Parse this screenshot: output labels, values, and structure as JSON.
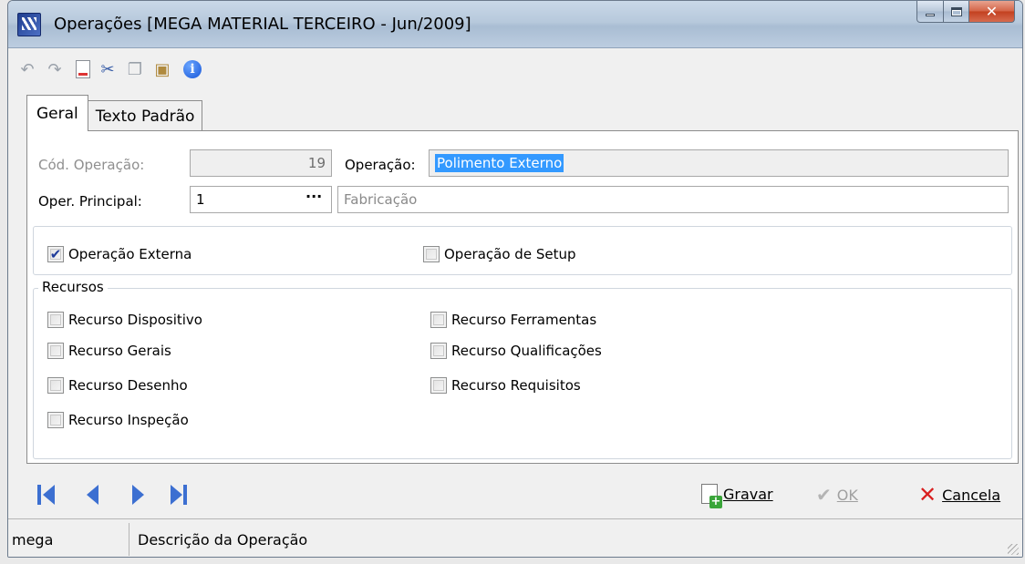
{
  "window": {
    "title": "Operações [MEGA MATERIAL TERCEIRO - Jun/2009]"
  },
  "toolbar": {
    "icons": [
      "undo-icon",
      "redo-icon",
      "new-document-icon",
      "cut-icon",
      "copy-icon",
      "paste-icon",
      "info-icon"
    ]
  },
  "tabs": [
    {
      "label": "Geral",
      "active": true
    },
    {
      "label": "Texto Padrão",
      "active": false
    }
  ],
  "form": {
    "cod_operacao_label": "Cód. Operação:",
    "cod_operacao_value": "19",
    "operacao_label": "Operação:",
    "operacao_value": "Polimento Externo",
    "oper_principal_label": "Oper. Principal:",
    "oper_principal_value": "1",
    "oper_principal_ellipsis": "···",
    "oper_principal_desc": "Fabricação"
  },
  "options": {
    "operacao_externa": {
      "label": "Operação Externa",
      "checked": true
    },
    "operacao_setup": {
      "label": "Operação de Setup",
      "checked": false
    }
  },
  "recursos": {
    "caption": "Recursos",
    "dispositivo": "Recurso Dispositivo",
    "gerais": "Recurso Gerais",
    "desenho": "Recurso Desenho",
    "inspecao": "Recurso Inspeção",
    "ferramentas": "Recurso Ferramentas",
    "qualificacoes": "Recurso Qualificações",
    "requisitos": "Recurso Requisitos"
  },
  "actions": {
    "gravar": "Gravar",
    "ok": "OK",
    "cancela": "Cancela"
  },
  "status": {
    "user": "mega",
    "description": "Descrição da Operação"
  },
  "colors": {
    "selection": "#3399ff",
    "nav_arrow": "#3c6fd1",
    "cancel_x": "#d91f1f",
    "checkbox_check": "#1f3c9a"
  }
}
